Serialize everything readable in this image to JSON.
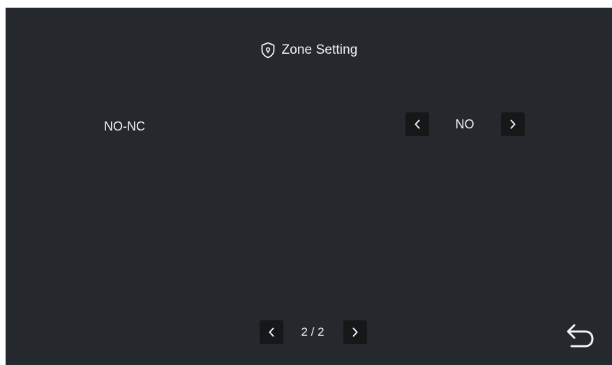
{
  "header": {
    "title": "Zone Setting",
    "icon": "shield-icon"
  },
  "setting": {
    "label": "NO-NC",
    "value": "NO",
    "prev_icon": "chevron-left-icon",
    "next_icon": "chevron-right-icon"
  },
  "pagination": {
    "page_text": "2 / 2",
    "prev_icon": "chevron-left-icon",
    "next_icon": "chevron-right-icon"
  },
  "footer": {
    "back_icon": "back-arrow-icon"
  },
  "colors": {
    "background": "#25282c",
    "button_background": "#161719",
    "text": "#f2f2f2"
  }
}
